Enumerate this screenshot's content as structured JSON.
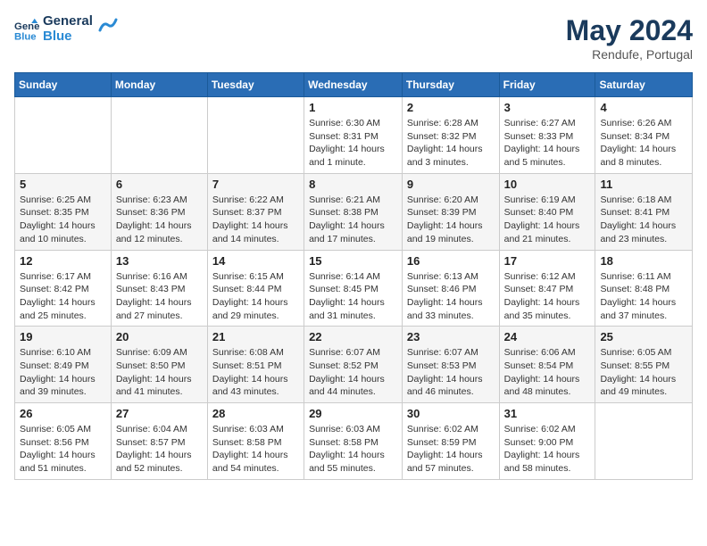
{
  "header": {
    "logo_line1": "General",
    "logo_line2": "Blue",
    "month_year": "May 2024",
    "location": "Rendufe, Portugal"
  },
  "weekdays": [
    "Sunday",
    "Monday",
    "Tuesday",
    "Wednesday",
    "Thursday",
    "Friday",
    "Saturday"
  ],
  "weeks": [
    [
      {
        "day": "",
        "text": ""
      },
      {
        "day": "",
        "text": ""
      },
      {
        "day": "",
        "text": ""
      },
      {
        "day": "1",
        "text": "Sunrise: 6:30 AM\nSunset: 8:31 PM\nDaylight: 14 hours\nand 1 minute."
      },
      {
        "day": "2",
        "text": "Sunrise: 6:28 AM\nSunset: 8:32 PM\nDaylight: 14 hours\nand 3 minutes."
      },
      {
        "day": "3",
        "text": "Sunrise: 6:27 AM\nSunset: 8:33 PM\nDaylight: 14 hours\nand 5 minutes."
      },
      {
        "day": "4",
        "text": "Sunrise: 6:26 AM\nSunset: 8:34 PM\nDaylight: 14 hours\nand 8 minutes."
      }
    ],
    [
      {
        "day": "5",
        "text": "Sunrise: 6:25 AM\nSunset: 8:35 PM\nDaylight: 14 hours\nand 10 minutes."
      },
      {
        "day": "6",
        "text": "Sunrise: 6:23 AM\nSunset: 8:36 PM\nDaylight: 14 hours\nand 12 minutes."
      },
      {
        "day": "7",
        "text": "Sunrise: 6:22 AM\nSunset: 8:37 PM\nDaylight: 14 hours\nand 14 minutes."
      },
      {
        "day": "8",
        "text": "Sunrise: 6:21 AM\nSunset: 8:38 PM\nDaylight: 14 hours\nand 17 minutes."
      },
      {
        "day": "9",
        "text": "Sunrise: 6:20 AM\nSunset: 8:39 PM\nDaylight: 14 hours\nand 19 minutes."
      },
      {
        "day": "10",
        "text": "Sunrise: 6:19 AM\nSunset: 8:40 PM\nDaylight: 14 hours\nand 21 minutes."
      },
      {
        "day": "11",
        "text": "Sunrise: 6:18 AM\nSunset: 8:41 PM\nDaylight: 14 hours\nand 23 minutes."
      }
    ],
    [
      {
        "day": "12",
        "text": "Sunrise: 6:17 AM\nSunset: 8:42 PM\nDaylight: 14 hours\nand 25 minutes."
      },
      {
        "day": "13",
        "text": "Sunrise: 6:16 AM\nSunset: 8:43 PM\nDaylight: 14 hours\nand 27 minutes."
      },
      {
        "day": "14",
        "text": "Sunrise: 6:15 AM\nSunset: 8:44 PM\nDaylight: 14 hours\nand 29 minutes."
      },
      {
        "day": "15",
        "text": "Sunrise: 6:14 AM\nSunset: 8:45 PM\nDaylight: 14 hours\nand 31 minutes."
      },
      {
        "day": "16",
        "text": "Sunrise: 6:13 AM\nSunset: 8:46 PM\nDaylight: 14 hours\nand 33 minutes."
      },
      {
        "day": "17",
        "text": "Sunrise: 6:12 AM\nSunset: 8:47 PM\nDaylight: 14 hours\nand 35 minutes."
      },
      {
        "day": "18",
        "text": "Sunrise: 6:11 AM\nSunset: 8:48 PM\nDaylight: 14 hours\nand 37 minutes."
      }
    ],
    [
      {
        "day": "19",
        "text": "Sunrise: 6:10 AM\nSunset: 8:49 PM\nDaylight: 14 hours\nand 39 minutes."
      },
      {
        "day": "20",
        "text": "Sunrise: 6:09 AM\nSunset: 8:50 PM\nDaylight: 14 hours\nand 41 minutes."
      },
      {
        "day": "21",
        "text": "Sunrise: 6:08 AM\nSunset: 8:51 PM\nDaylight: 14 hours\nand 43 minutes."
      },
      {
        "day": "22",
        "text": "Sunrise: 6:07 AM\nSunset: 8:52 PM\nDaylight: 14 hours\nand 44 minutes."
      },
      {
        "day": "23",
        "text": "Sunrise: 6:07 AM\nSunset: 8:53 PM\nDaylight: 14 hours\nand 46 minutes."
      },
      {
        "day": "24",
        "text": "Sunrise: 6:06 AM\nSunset: 8:54 PM\nDaylight: 14 hours\nand 48 minutes."
      },
      {
        "day": "25",
        "text": "Sunrise: 6:05 AM\nSunset: 8:55 PM\nDaylight: 14 hours\nand 49 minutes."
      }
    ],
    [
      {
        "day": "26",
        "text": "Sunrise: 6:05 AM\nSunset: 8:56 PM\nDaylight: 14 hours\nand 51 minutes."
      },
      {
        "day": "27",
        "text": "Sunrise: 6:04 AM\nSunset: 8:57 PM\nDaylight: 14 hours\nand 52 minutes."
      },
      {
        "day": "28",
        "text": "Sunrise: 6:03 AM\nSunset: 8:58 PM\nDaylight: 14 hours\nand 54 minutes."
      },
      {
        "day": "29",
        "text": "Sunrise: 6:03 AM\nSunset: 8:58 PM\nDaylight: 14 hours\nand 55 minutes."
      },
      {
        "day": "30",
        "text": "Sunrise: 6:02 AM\nSunset: 8:59 PM\nDaylight: 14 hours\nand 57 minutes."
      },
      {
        "day": "31",
        "text": "Sunrise: 6:02 AM\nSunset: 9:00 PM\nDaylight: 14 hours\nand 58 minutes."
      },
      {
        "day": "",
        "text": ""
      }
    ]
  ]
}
